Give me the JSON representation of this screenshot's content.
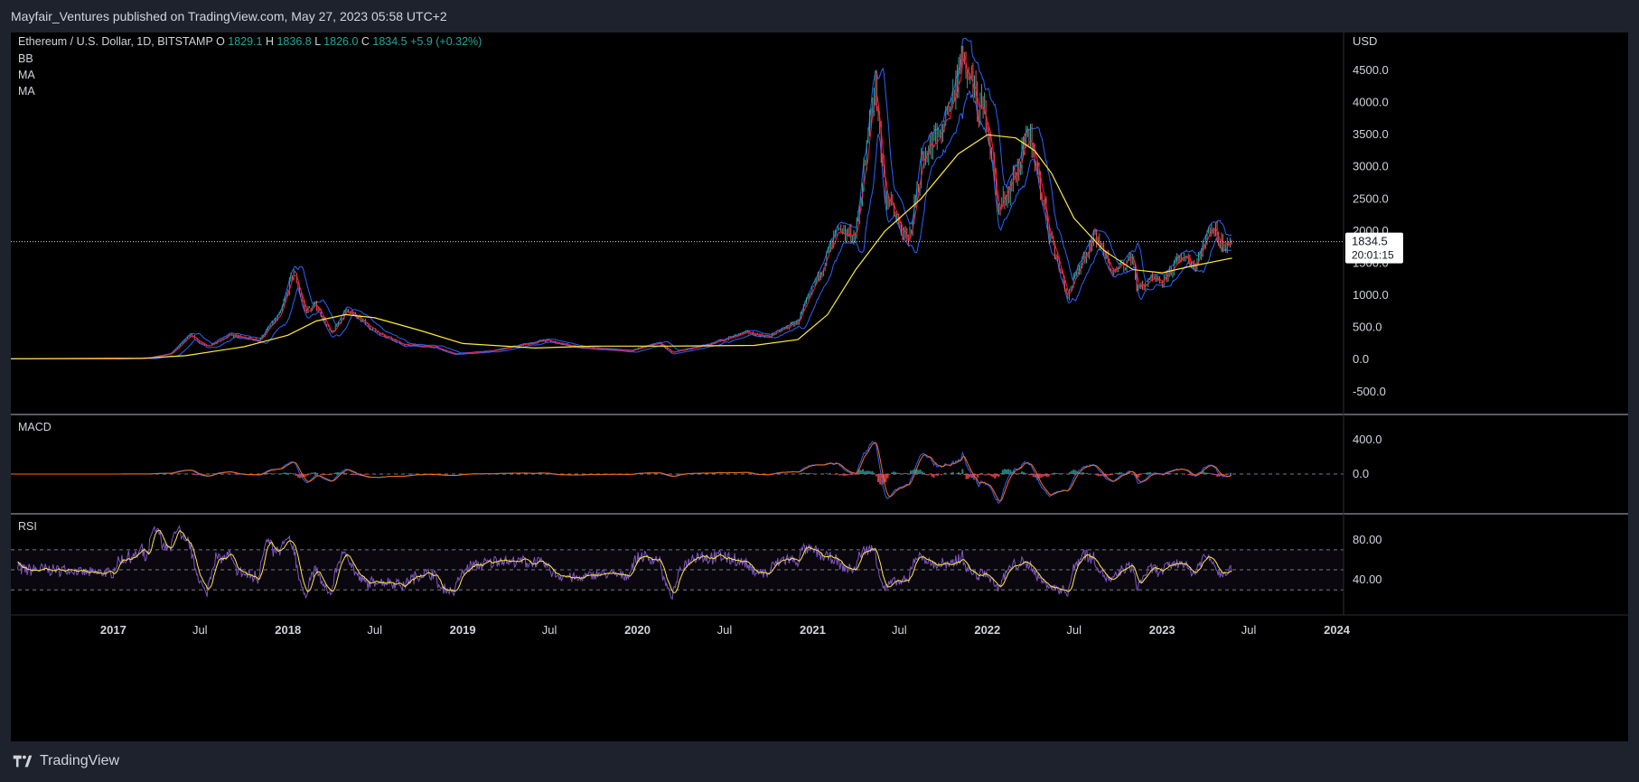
{
  "header": {
    "published": "Mayfair_Ventures published on TradingView.com, May 27, 2023 05:58 UTC+2"
  },
  "legend": {
    "symbol": "Ethereum / U.S. Dollar, 1D, BITSTAMP",
    "o_label": "O",
    "o_value": "1829.1",
    "h_label": "H",
    "h_value": "1836.8",
    "l_label": "L",
    "l_value": "1826.0",
    "c_label": "C",
    "c_value": "1834.5",
    "change": "+5.9 (+0.32%)",
    "indicators": [
      "BB",
      "MA",
      "MA"
    ]
  },
  "price_axis": {
    "currency": "USD",
    "ticks": [
      "4500.0",
      "4000.0",
      "3500.0",
      "3000.0",
      "2500.0",
      "2000.0",
      "1500.0",
      "1000.0",
      "500.0",
      "0.0",
      "-500.0"
    ],
    "last_price": "1834.5",
    "countdown": "20:01:15"
  },
  "macd": {
    "label": "MACD",
    "ticks": [
      "400.0",
      "0.0"
    ]
  },
  "rsi": {
    "label": "RSI",
    "ticks": [
      "80.00",
      "40.00"
    ]
  },
  "time_axis": {
    "labels": [
      "2017",
      "Jul",
      "2018",
      "Jul",
      "2019",
      "Jul",
      "2020",
      "Jul",
      "2021",
      "Jul",
      "2022",
      "Jul",
      "2023",
      "Jul",
      "2024"
    ]
  },
  "footer": {
    "brand": "TradingView"
  },
  "colors": {
    "background": "#000000",
    "frame": "#1e222d",
    "up": "#26a69a",
    "down": "#ef5350",
    "bb": "#2962ff",
    "ma_fast": "#ff1744",
    "ma_slow": "#ffeb3b",
    "rsi": "#7e57c2",
    "text": "#d1d4dc"
  },
  "chart_data": {
    "type": "line",
    "title": "Ethereum / U.S. Dollar, 1D, BITSTAMP",
    "ylabel": "USD",
    "ylim": [
      -700,
      4950
    ],
    "x_range": [
      "2016-06-01",
      "2024-01-15"
    ],
    "series": [
      {
        "name": "ETH/USD",
        "x": [
          "2016-06-01",
          "2016-10-01",
          "2017-01-01",
          "2017-03-15",
          "2017-05-01",
          "2017-06-12",
          "2017-07-15",
          "2017-09-01",
          "2017-11-01",
          "2017-12-15",
          "2018-01-13",
          "2018-02-06",
          "2018-03-01",
          "2018-04-01",
          "2018-05-05",
          "2018-07-01",
          "2018-09-01",
          "2018-11-01",
          "2018-12-15",
          "2019-03-01",
          "2019-06-25",
          "2019-09-01",
          "2019-12-15",
          "2020-02-15",
          "2020-03-13",
          "2020-06-01",
          "2020-08-15",
          "2020-10-01",
          "2020-12-01",
          "2021-01-10",
          "2021-02-20",
          "2021-04-01",
          "2021-05-12",
          "2021-06-01",
          "2021-07-20",
          "2021-08-20",
          "2021-09-15",
          "2021-10-15",
          "2021-11-10",
          "2021-12-05",
          "2022-01-01",
          "2022-01-24",
          "2022-03-01",
          "2022-04-02",
          "2022-05-10",
          "2022-06-18",
          "2022-07-15",
          "2022-08-14",
          "2022-09-20",
          "2022-11-01",
          "2022-11-10",
          "2022-12-15",
          "2023-01-01",
          "2023-02-15",
          "2023-03-10",
          "2023-04-16",
          "2023-05-01",
          "2023-05-27"
        ],
        "values": [
          12,
          12,
          10,
          20,
          90,
          380,
          200,
          380,
          300,
          700,
          1380,
          750,
          850,
          400,
          780,
          450,
          230,
          200,
          90,
          130,
          300,
          190,
          130,
          260,
          110,
          240,
          420,
          360,
          590,
          1250,
          1950,
          1950,
          4300,
          2600,
          1800,
          3200,
          3400,
          3800,
          4800,
          4100,
          3750,
          2300,
          2900,
          3500,
          2000,
          1000,
          1500,
          1950,
          1350,
          1600,
          1100,
          1250,
          1200,
          1650,
          1450,
          2100,
          1850,
          1834.5
        ]
      },
      {
        "name": "MA (slow)",
        "x": [
          "2016-06-01",
          "2017-03-01",
          "2017-06-01",
          "2017-10-01",
          "2018-01-01",
          "2018-03-01",
          "2018-05-01",
          "2018-07-01",
          "2018-10-01",
          "2019-01-01",
          "2019-06-01",
          "2019-10-01",
          "2020-03-01",
          "2020-09-01",
          "2020-12-01",
          "2021-02-01",
          "2021-04-01",
          "2021-06-01",
          "2021-08-15",
          "2021-11-01",
          "2022-01-01",
          "2022-03-01",
          "2022-04-10",
          "2022-05-15",
          "2022-07-01",
          "2022-09-01",
          "2022-11-01",
          "2023-01-01",
          "2023-03-01",
          "2023-05-27"
        ],
        "values": [
          12,
          20,
          60,
          200,
          380,
          600,
          700,
          650,
          460,
          250,
          180,
          210,
          210,
          220,
          310,
          700,
          1400,
          2000,
          2500,
          3200,
          3500,
          3450,
          3250,
          2900,
          2200,
          1700,
          1400,
          1350,
          1450,
          1580
        ]
      }
    ],
    "indicators": {
      "macd": {
        "ylim": [
          -450,
          680
        ],
        "last": 0
      },
      "rsi": {
        "ylim": [
          5,
          105
        ],
        "levels": [
          70,
          50,
          30
        ]
      }
    }
  }
}
